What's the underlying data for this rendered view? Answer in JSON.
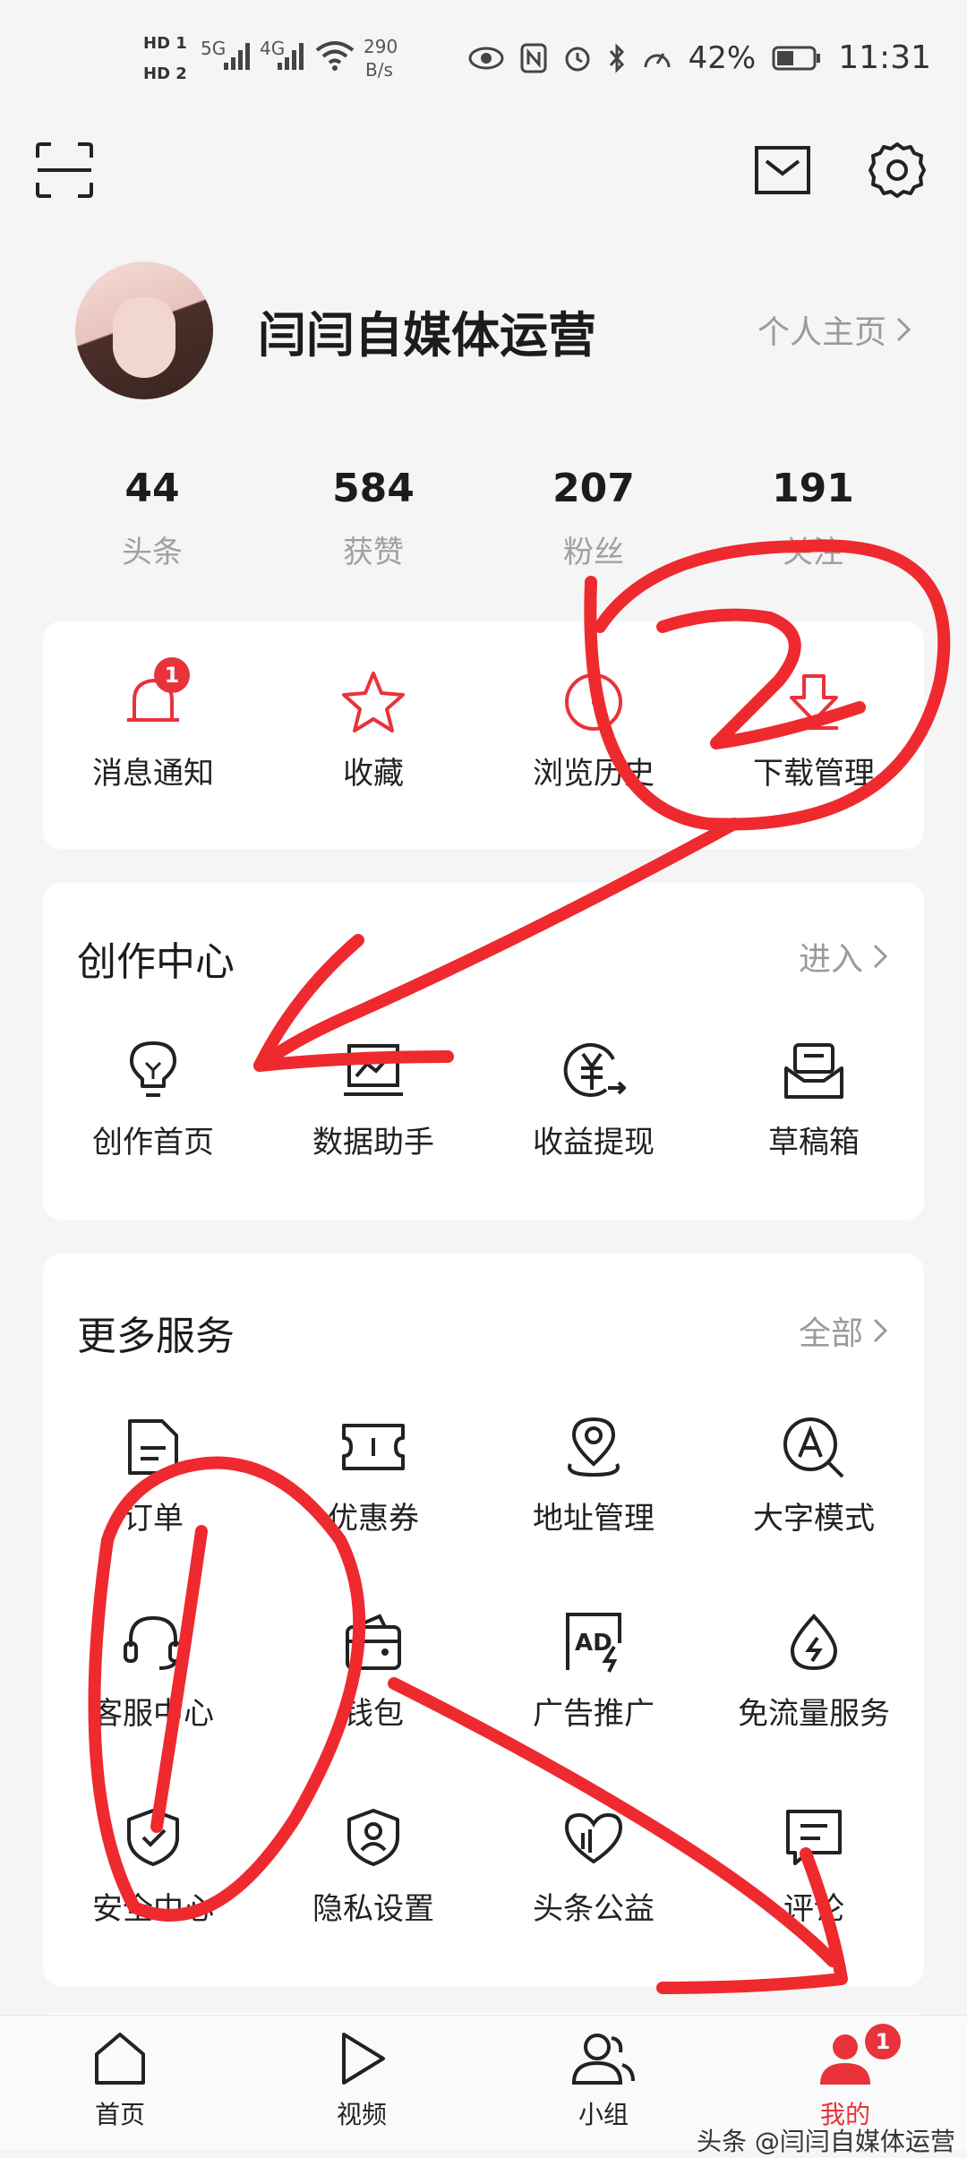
{
  "status_bar": {
    "hd1": "HD 1",
    "hd2": "HD 2",
    "net1": "5G",
    "net2": "4G",
    "speed_value": "290",
    "speed_unit": "B/s",
    "battery": "42%",
    "time": "11:31"
  },
  "header": {
    "scan_icon": "scan-icon",
    "mail_icon": "mail-icon",
    "settings_icon": "gear-icon"
  },
  "profile": {
    "username": "闫闫自媒体运营",
    "homepage_link": "个人主页"
  },
  "stats": [
    {
      "value": "44",
      "label": "头条"
    },
    {
      "value": "584",
      "label": "获赞"
    },
    {
      "value": "207",
      "label": "粉丝"
    },
    {
      "value": "191",
      "label": "关注"
    }
  ],
  "quick_actions": [
    {
      "label": "消息通知",
      "icon": "bell-icon",
      "badge": "1"
    },
    {
      "label": "收藏",
      "icon": "star-icon"
    },
    {
      "label": "浏览历史",
      "icon": "clock-icon"
    },
    {
      "label": "下载管理",
      "icon": "download-icon"
    }
  ],
  "creation_center": {
    "title": "创作中心",
    "link": "进入",
    "items": [
      {
        "label": "创作首页",
        "icon": "lightbulb-icon"
      },
      {
        "label": "数据助手",
        "icon": "chart-icon"
      },
      {
        "label": "收益提现",
        "icon": "yen-icon"
      },
      {
        "label": "草稿箱",
        "icon": "drafts-icon"
      }
    ]
  },
  "more_services": {
    "title": "更多服务",
    "link": "全部",
    "items": [
      {
        "label": "订单",
        "icon": "order-icon"
      },
      {
        "label": "优惠券",
        "icon": "coupon-icon"
      },
      {
        "label": "地址管理",
        "icon": "location-icon"
      },
      {
        "label": "大字模式",
        "icon": "large-font-icon"
      },
      {
        "label": "客服中心",
        "icon": "headset-icon"
      },
      {
        "label": "钱包",
        "icon": "wallet-icon"
      },
      {
        "label": "广告推广",
        "icon": "ad-icon"
      },
      {
        "label": "免流量服务",
        "icon": "data-free-icon"
      },
      {
        "label": "安全中心",
        "icon": "shield-icon"
      },
      {
        "label": "隐私设置",
        "icon": "privacy-icon"
      },
      {
        "label": "头条公益",
        "icon": "charity-icon"
      },
      {
        "label": "评论",
        "icon": "comment-icon"
      }
    ]
  },
  "bottom_nav": [
    {
      "label": "首页",
      "icon": "home-icon"
    },
    {
      "label": "视频",
      "icon": "play-icon"
    },
    {
      "label": "小组",
      "icon": "group-icon"
    },
    {
      "label": "我的",
      "icon": "profile-icon",
      "badge": "1",
      "active": true
    }
  ],
  "watermark": "头条 @闫闫自媒体运营",
  "colors": {
    "accent": "#e8333b",
    "annotation": "#ee2a2f"
  }
}
